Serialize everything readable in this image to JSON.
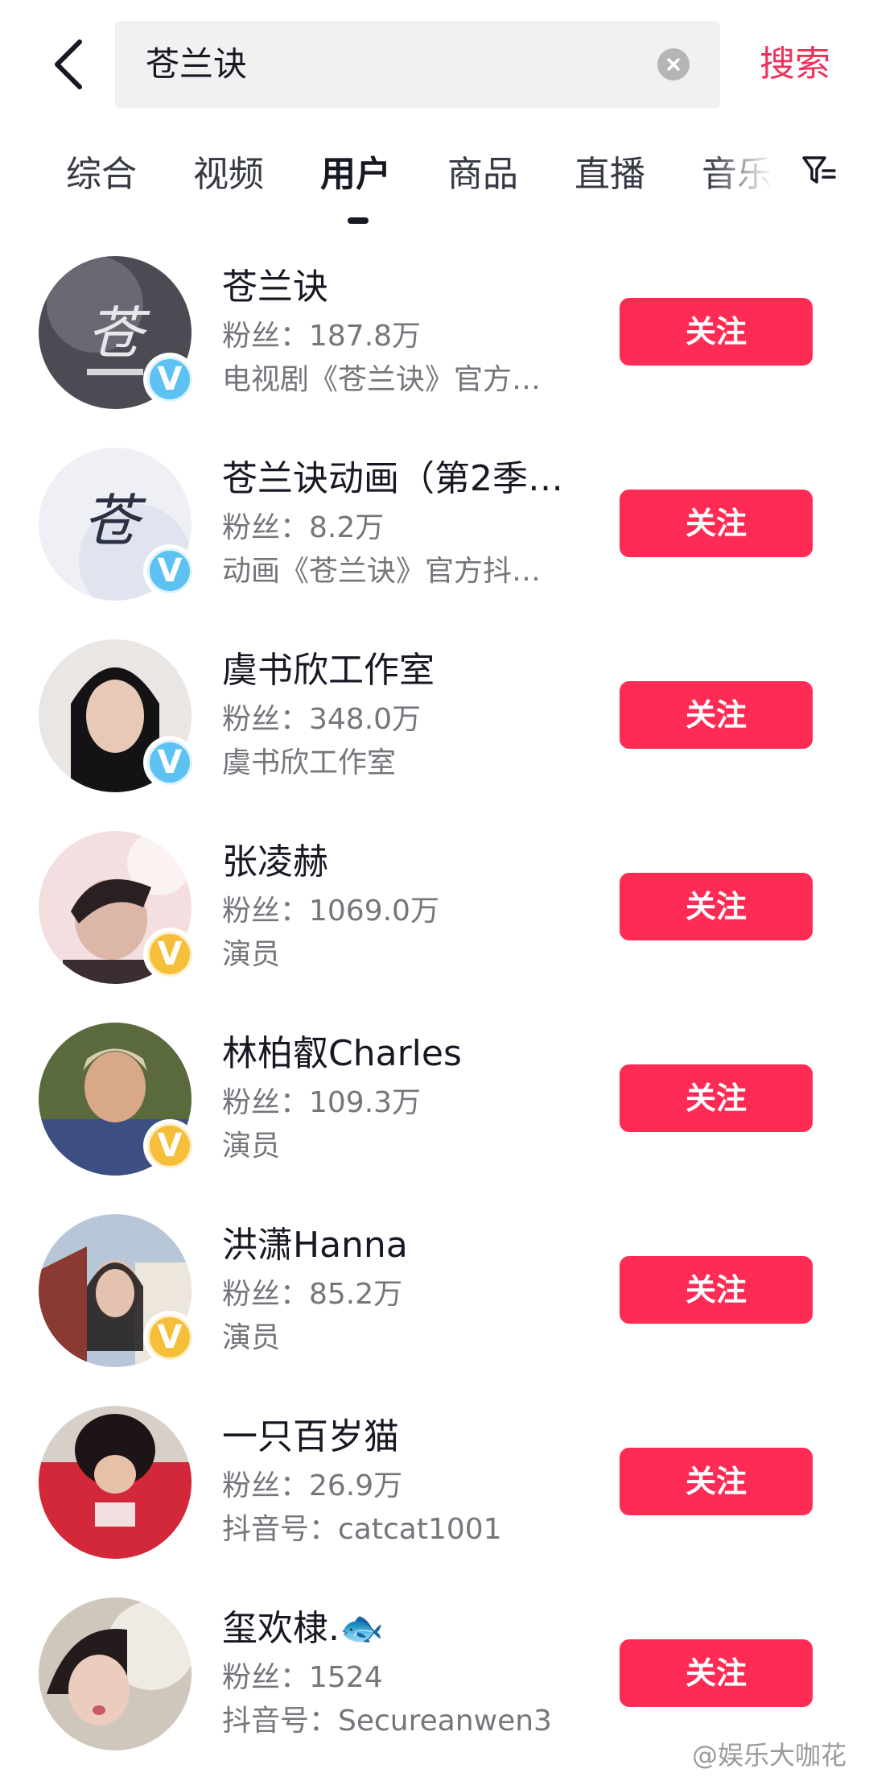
{
  "search": {
    "query": "苍兰诀",
    "submit_label": "搜索"
  },
  "tabs": [
    {
      "label": "综合"
    },
    {
      "label": "视频"
    },
    {
      "label": "用户"
    },
    {
      "label": "商品"
    },
    {
      "label": "直播"
    },
    {
      "label": "音乐"
    }
  ],
  "active_tab": "用户",
  "follow_label": "关注",
  "users": [
    {
      "name": "苍兰诀",
      "fans": "粉丝：187.8万",
      "desc": "电视剧《苍兰诀》官方…",
      "badge": "blue"
    },
    {
      "name": "苍兰诀动画（第2季…",
      "fans": "粉丝：8.2万",
      "desc": "动画《苍兰诀》官方抖…",
      "badge": "blue"
    },
    {
      "name": "虞书欣工作室",
      "fans": "粉丝：348.0万",
      "desc": "虞书欣工作室",
      "badge": "blue"
    },
    {
      "name": "张凌赫",
      "fans": "粉丝：1069.0万",
      "desc": "演员",
      "badge": "gold"
    },
    {
      "name": "林柏叡Charles",
      "fans": "粉丝：109.3万",
      "desc": "演员",
      "badge": "gold"
    },
    {
      "name": "洪潇Hanna",
      "fans": "粉丝：85.2万",
      "desc": "演员",
      "badge": "gold"
    },
    {
      "name": "一只百岁猫",
      "fans": "粉丝：26.9万",
      "desc": "抖音号：catcat1001",
      "badge": ""
    },
    {
      "name": "玺欢棣.🐟",
      "fans": "粉丝：1524",
      "desc": "抖音号：Secureanwen3",
      "badge": ""
    }
  ],
  "watermark": "@娱乐大咖花",
  "colors": {
    "accent": "#fe2c55",
    "search_accent": "#ee3159",
    "verified_blue": "#5dc1f2",
    "verified_gold": "#f6bf3a"
  }
}
